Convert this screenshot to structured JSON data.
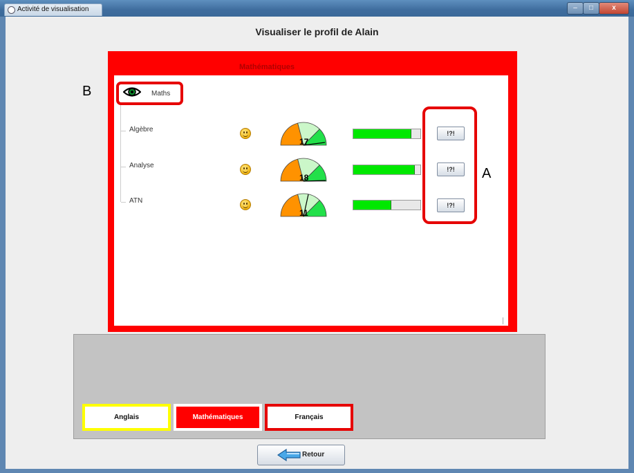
{
  "window": {
    "title": "Activité de visualisation",
    "controls": {
      "minimize": "–",
      "maximize": "□",
      "close": "x"
    }
  },
  "page": {
    "title": "Visualiser le profil de Alain"
  },
  "panel": {
    "title": "Mathématiques",
    "color": "#ff0000",
    "tree_root": {
      "label": "Maths",
      "icon": "eye-icon"
    },
    "rows": [
      {
        "label": "Algèbre",
        "gauge_value": "17",
        "score": 17,
        "bar_fraction": 0.86,
        "help_label": "!?!"
      },
      {
        "label": "Analyse",
        "gauge_value": "18",
        "score": 18,
        "bar_fraction": 0.91,
        "help_label": "!?!"
      },
      {
        "label": "ATN",
        "gauge_value": "11",
        "score": 11,
        "bar_fraction": 0.56,
        "help_label": "!?!"
      }
    ]
  },
  "annotations": {
    "a": "A",
    "b": "B"
  },
  "subject_tabs": [
    {
      "label": "Anglais",
      "border_color": "#ffff00",
      "selected": false
    },
    {
      "label": "Mathématiques",
      "border_color": "#ffffff",
      "selected": true
    },
    {
      "label": "Français",
      "border_color": "#e60000",
      "selected": false
    }
  ],
  "footer": {
    "retour_label": "Retour"
  }
}
